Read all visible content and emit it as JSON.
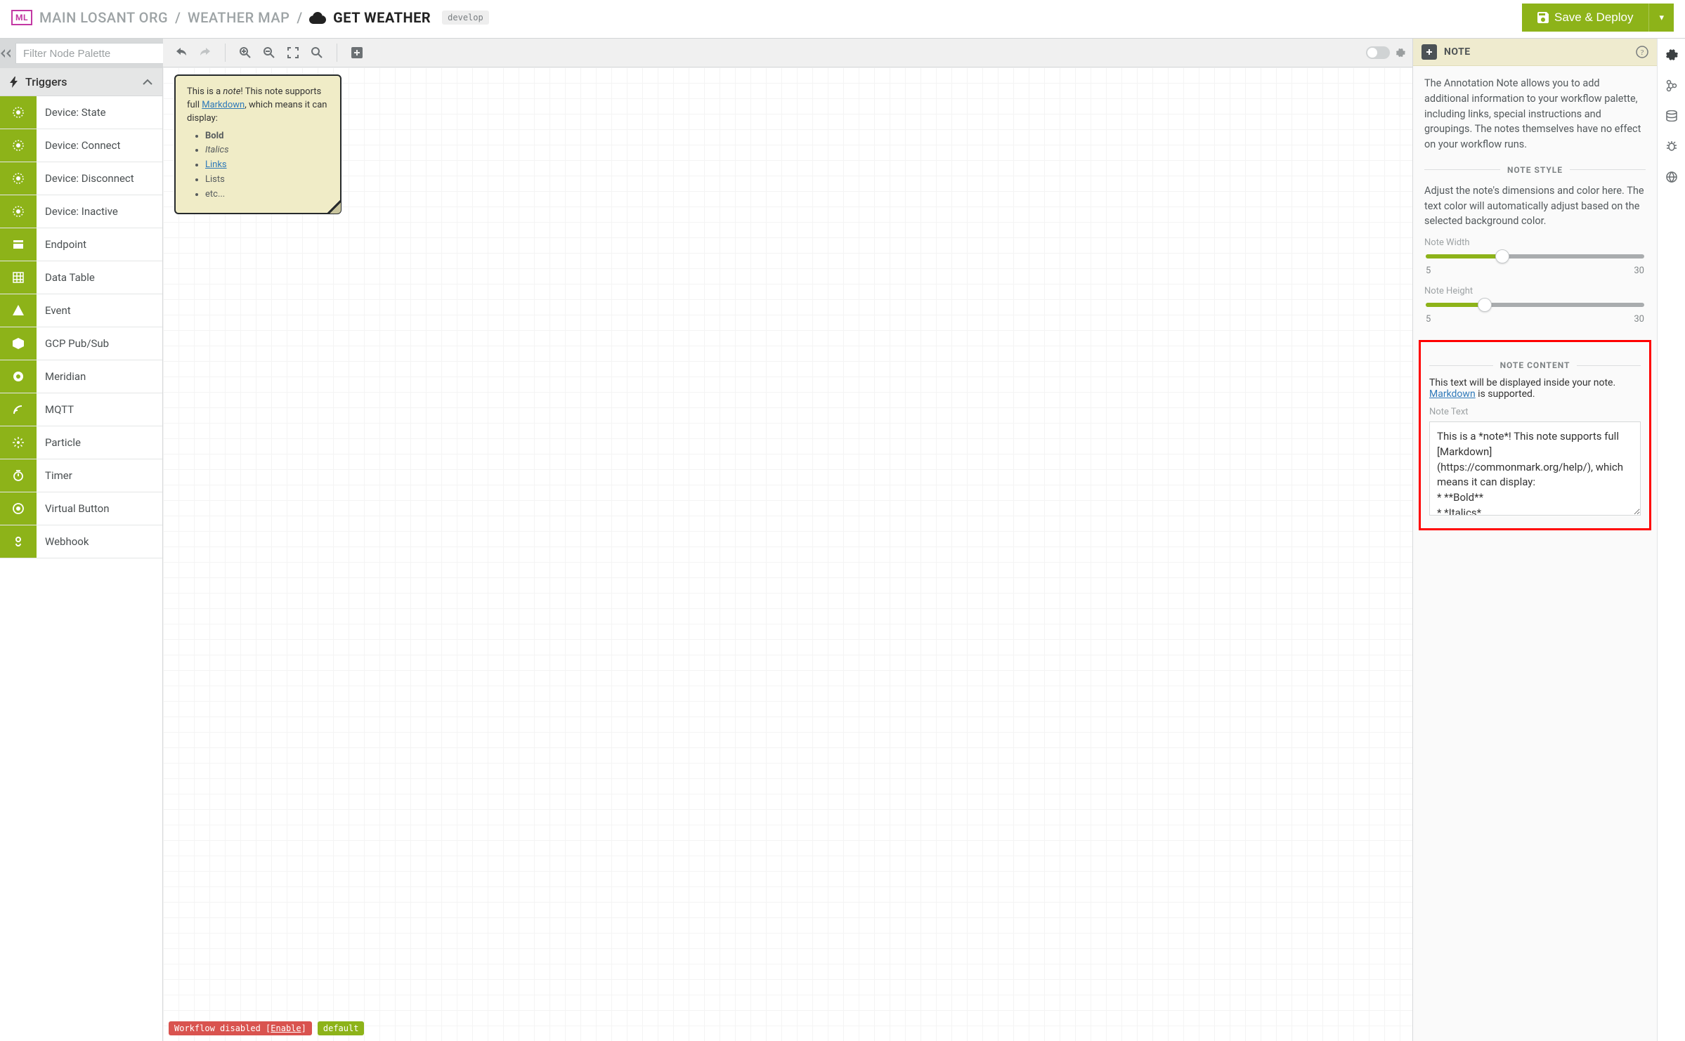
{
  "header": {
    "logo": "ML",
    "crumbs": [
      "MAIN LOSANT ORG",
      "WEATHER MAP",
      "GET WEATHER"
    ],
    "branch_tag": "develop",
    "deploy_label": "Save & Deploy"
  },
  "palette": {
    "filter_placeholder": "Filter Node Palette",
    "group_title": "Triggers",
    "items": [
      {
        "label": "Device: State",
        "icon": "trigger"
      },
      {
        "label": "Device: Connect",
        "icon": "trigger"
      },
      {
        "label": "Device: Disconnect",
        "icon": "trigger"
      },
      {
        "label": "Device: Inactive",
        "icon": "trigger"
      },
      {
        "label": "Endpoint",
        "icon": "endpoint"
      },
      {
        "label": "Data Table",
        "icon": "table"
      },
      {
        "label": "Event",
        "icon": "event"
      },
      {
        "label": "GCP Pub/Sub",
        "icon": "pubsub"
      },
      {
        "label": "Meridian",
        "icon": "meridian"
      },
      {
        "label": "MQTT",
        "icon": "mqtt"
      },
      {
        "label": "Particle",
        "icon": "particle"
      },
      {
        "label": "Timer",
        "icon": "timer"
      },
      {
        "label": "Virtual Button",
        "icon": "vbutton"
      },
      {
        "label": "Webhook",
        "icon": "webhook"
      }
    ]
  },
  "note": {
    "pre": "This is a ",
    "emph": "note",
    "mid": "! This note supports full ",
    "link": "Markdown",
    "post": ", which means it can display:",
    "bullets": {
      "b": "Bold",
      "i": "Italics",
      "l": "Links",
      "li": "Lists",
      "e": "etc..."
    }
  },
  "footer": {
    "disabled_prefix": "Workflow disabled ",
    "enable_label": "Enable",
    "default_label": "default"
  },
  "props": {
    "title": "NOTE",
    "description": "The Annotation Note allows you to add additional information to your workflow palette, including links, special instructions and groupings. The notes themselves have no effect on your workflow runs.",
    "style_heading": "NOTE STYLE",
    "style_desc": "Adjust the note's dimensions and color here. The text color will automatically adjust based on the selected background color.",
    "width_label": "Note Width",
    "height_label": "Note Height",
    "slider_min": "5",
    "slider_max": "30",
    "width_pct": 35,
    "height_pct": 27,
    "content_heading": "NOTE CONTENT",
    "content_desc_pre": "This text will be displayed inside your note. ",
    "content_link": "Markdown",
    "content_desc_post": " is supported.",
    "text_label": "Note Text",
    "text_value": "This is a *note*! This note supports full [Markdown](https://commonmark.org/help/), which means it can display:\n* **Bold**\n* *Italics*"
  }
}
